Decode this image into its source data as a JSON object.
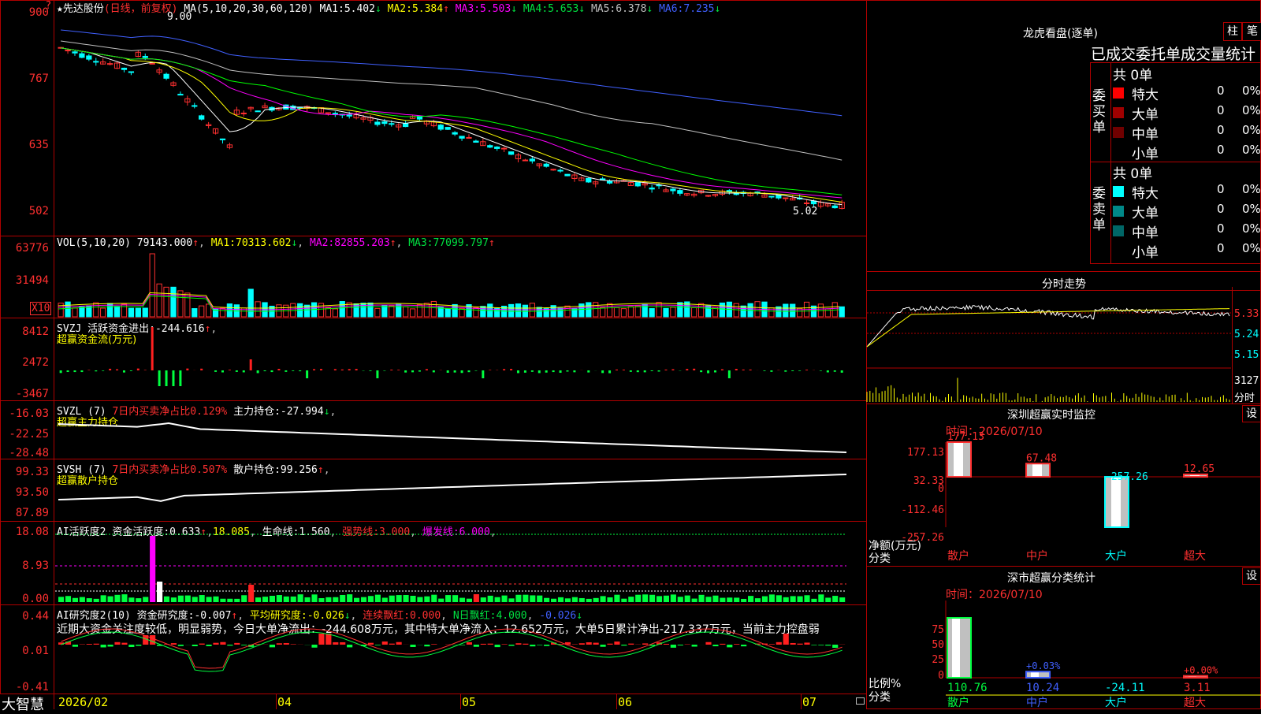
{
  "colors": {
    "up": "#ff3030",
    "down": "#00ffff",
    "grid": "#b00000",
    "ma1": "#ffffff",
    "ma2": "#ffff00",
    "ma3": "#ff00ff",
    "ma4": "#00ff00",
    "ma5": "#c0c0c0",
    "ma6": "#4060ff"
  },
  "main": {
    "stock_name": "★先达股份",
    "period": "(日线，前复权)",
    "ma_prefix": "MA(5,10,20,30,60,120)",
    "ma": [
      {
        "label": "MA1:",
        "value": "5.402",
        "arrow": "↓"
      },
      {
        "label": "MA2:",
        "value": "5.384",
        "arrow": "↑"
      },
      {
        "label": "MA3:",
        "value": "5.503",
        "arrow": "↓"
      },
      {
        "label": "MA4:",
        "value": "5.653",
        "arrow": "↓"
      },
      {
        "label": "MA5:",
        "value": "6.378",
        "arrow": "↓"
      },
      {
        "label": "MA6:",
        "value": "7.235",
        "arrow": "↓"
      }
    ],
    "high_label": "9.00",
    "low_label": "5.02",
    "y_ticks": [
      "900",
      "767",
      "635",
      "502"
    ],
    "marker_q": "?"
  },
  "vol": {
    "prefix": "VOL(5,10,20)",
    "value": "79143.000",
    "ma": [
      {
        "label": "MA1:",
        "value": "70313.602",
        "arrow": "↓"
      },
      {
        "label": "MA2:",
        "value": "82855.203",
        "arrow": "↑"
      },
      {
        "label": "MA3:",
        "value": "77099.797",
        "arrow": "↑"
      }
    ],
    "y_ticks": [
      "63776",
      "31494"
    ],
    "unit": "X10"
  },
  "svzj": {
    "name": "SVZJ",
    "label": "活跃资金进出:",
    "value": "-244.616",
    "arrow": "↑",
    "sub": "超赢资金流(万元)",
    "y_ticks": [
      "8412",
      "2472",
      "-3467"
    ]
  },
  "svzl": {
    "name": "SVZL (7)",
    "ratio": "7日内买卖净占比0.129%",
    "label": "主力持仓:",
    "value": "-27.994",
    "arrow": "↓",
    "sub": "超赢主力持仓",
    "y_ticks": [
      "-16.03",
      "-22.25",
      "-28.48"
    ]
  },
  "svsh": {
    "name": "SVSH (7)",
    "ratio": "7日内买卖净占比0.507%",
    "label": "散户持仓:",
    "value": "99.256",
    "arrow": "↑",
    "sub": "超赢散户持仓",
    "y_ticks": [
      "99.33",
      "93.50",
      "87.89"
    ]
  },
  "ai2": {
    "name": "AI活跃度2",
    "label": "资金活跃度:",
    "value": "0.633",
    "v2": "18.085",
    "life": "生命线:",
    "life_v": "1.560",
    "strong": "强势线:",
    "strong_v": "3.000",
    "burst": "爆发线:",
    "burst_v": "6.000",
    "y_ticks": [
      "18.08",
      "8.93",
      "0.00"
    ]
  },
  "ai_research": {
    "name": "AI研究度2(10)",
    "label": "资金研究度:",
    "value": "-0.007",
    "avg": "平均研究度:",
    "avg_v": "-0.026",
    "cont": "连续飘红:",
    "cont_v": "0.000",
    "nday": "N日飘红:",
    "nday_v": "4.000",
    "last": "-0.026",
    "comment": "近期大资金关注度较低，明显弱势，今日大单净流出：-244.608万元，其中特大单净流入：12.652万元，大单5日累计净出-217.337万元，当前主力控盘弱",
    "y_ticks": [
      "0.44",
      "0.01",
      "-0.41"
    ]
  },
  "x_axis": {
    "labels": [
      "2026/02",
      "04",
      "05",
      "06",
      "07"
    ],
    "brand": "大智慧"
  },
  "lhb": {
    "title": "龙虎看盘(逐单)",
    "btn_zhu": "柱",
    "btn_bi": "笔",
    "subtitle": "已成交委托单成交量统计",
    "buy_side": "委买单",
    "sell_side": "委卖单",
    "buy_total": "共 0单",
    "sell_total": "共 0单",
    "buy_rows": [
      {
        "name": "特大",
        "count": "0",
        "pct": "0%",
        "color": "#ff0000"
      },
      {
        "name": "大单",
        "count": "0",
        "pct": "0%",
        "color": "#a00000"
      },
      {
        "name": "中单",
        "count": "0",
        "pct": "0%",
        "color": "#700000"
      },
      {
        "name": "小单",
        "count": "0",
        "pct": "0%",
        "color": "#000000"
      }
    ],
    "sell_rows": [
      {
        "name": "特大",
        "count": "0",
        "pct": "0%",
        "color": "#00ffff"
      },
      {
        "name": "大单",
        "count": "0",
        "pct": "0%",
        "color": "#008888"
      },
      {
        "name": "中单",
        "count": "0",
        "pct": "0%",
        "color": "#006666"
      },
      {
        "name": "小单",
        "count": "0",
        "pct": "0%",
        "color": "#000000"
      }
    ]
  },
  "intraday": {
    "title": "分时走势",
    "prices": [
      "5.33",
      "5.24",
      "5.15"
    ],
    "vol_label": "3127",
    "vol_unit": "分时"
  },
  "sz_monitor": {
    "title": "深圳超赢实时监控",
    "btn": "设",
    "time": "时间：2026/07/10",
    "y_ticks": [
      "177.13",
      "32.33",
      "0",
      "-112.46",
      "-257.26"
    ],
    "y_caption": "净额(万元)",
    "x_caption": "分类"
  },
  "sz_class": {
    "title": "深市超赢分类统计",
    "btn": "设",
    "time": "时间：2026/07/10",
    "y_ticks": [
      "75",
      "50",
      "25",
      "0"
    ],
    "y_caption": "比例%",
    "x_caption": "分类"
  },
  "chart_data": [
    {
      "type": "bar",
      "title": "深圳超赢实时监控",
      "categories": [
        "散户",
        "中户",
        "大户",
        "超大"
      ],
      "values": [
        177.13,
        67.48,
        -257.26,
        12.65
      ],
      "ylabel": "净额(万元)",
      "ylim": [
        -257.26,
        177.13
      ]
    },
    {
      "type": "bar",
      "title": "深市超赢分类统计",
      "categories": [
        "散户",
        "中户",
        "大户",
        "超大"
      ],
      "values": [
        110.76,
        10.24,
        -24.11,
        3.11
      ],
      "annotations": [
        "",
        "+0.03%",
        "",
        "+0.00%"
      ],
      "ylabel": "比例%",
      "ylim": [
        0,
        100
      ]
    }
  ]
}
